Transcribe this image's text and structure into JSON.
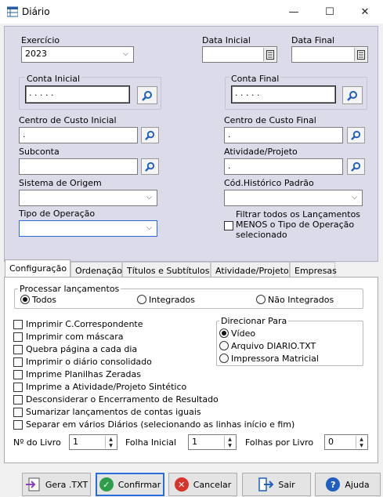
{
  "window": {
    "title": "Diário",
    "minimize_glyph": "—",
    "maximize_glyph": "☐",
    "close_glyph": "✕"
  },
  "filters": {
    "exercicio_label": "Exercício",
    "exercicio_value": "2023",
    "data_inicial_label": "Data Inicial",
    "data_inicial_value": "",
    "data_final_label": "Data Final",
    "data_final_value": "",
    "conta_inicial_label": "Conta Inicial",
    "conta_inicial_value": ". . . . .",
    "conta_final_label": "Conta Final",
    "conta_final_value": ". . . . .",
    "cc_inicial_label": "Centro de Custo Inicial",
    "cc_inicial_value": ".",
    "cc_final_label": "Centro de Custo Final",
    "cc_final_value": ".",
    "subconta_label": "Subconta",
    "subconta_value": "",
    "atividade_label": "Atividade/Projeto",
    "atividade_value": ".",
    "sistema_origem_label": "Sistema de Origem",
    "sistema_origem_value": "",
    "cod_historico_label": "Cód.Histórico Padrão",
    "cod_historico_value": "",
    "tipo_operacao_label": "Tipo de Operação",
    "tipo_operacao_value": "",
    "filtrar_line1": "Filtrar todos os Lançamentos",
    "filtrar_line2": "MENOS o Tipo de Operação",
    "filtrar_line3": "selecionado"
  },
  "tabs": [
    {
      "label": "Configuração"
    },
    {
      "label": "Ordenação"
    },
    {
      "label": "Títulos e Subtítulos"
    },
    {
      "label": "Atividade/Projeto"
    },
    {
      "label": "Empresas"
    }
  ],
  "config": {
    "processar_title": "Processar lançamentos",
    "processar_options": [
      "Todos",
      "Integrados",
      "Não Integrados"
    ],
    "checkboxes": [
      "Imprimir C.Correspondente",
      "Imprimir com máscara",
      "Quebra página a cada dia",
      "Imprimir o diário consolidado",
      "Imprime Planilhas Zeradas",
      "Imprime a Atividade/Projeto Sintético",
      "Desconsiderar o Encerramento de Resultado",
      "Sumarizar lançamentos de contas iguais",
      "Separar em vários Diários (selecionando as linhas início e fim)"
    ],
    "direcionar_title": "Direcionar Para",
    "direcionar_options": [
      "Vídeo",
      "Arquivo DIARIO.TXT",
      "Impressora Matricial"
    ],
    "num_livro_label": "Nº do Livro",
    "num_livro_value": "1",
    "folha_inicial_label": "Folha Inicial",
    "folha_inicial_value": "1",
    "folhas_por_livro_label": "Folhas por Livro",
    "folhas_por_livro_value": "0"
  },
  "buttons": {
    "gera_txt": "Gera .TXT",
    "confirmar": "Confirmar",
    "cancelar": "Cancelar",
    "sair": "Sair",
    "ajuda": "Ajuda"
  },
  "colors": {
    "panel_bg": "#dcdbea",
    "accent": "#2b6cd8",
    "confirm_green": "#2e9e4a",
    "cancel_red": "#d9342b",
    "help_blue": "#1f5fbf"
  }
}
